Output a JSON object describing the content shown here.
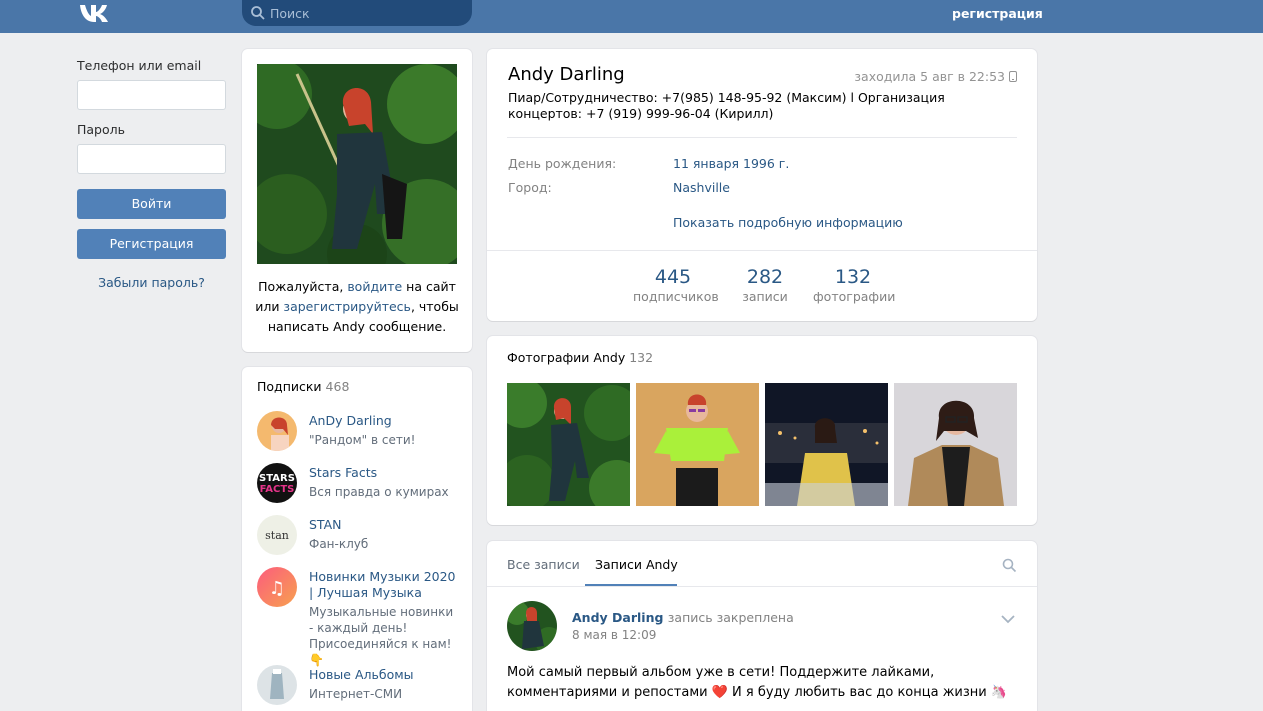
{
  "header": {
    "search_placeholder": "Поиск",
    "register_link": "регистрация"
  },
  "login": {
    "phone_label": "Телефон или email",
    "password_label": "Пароль",
    "login_button": "Войти",
    "register_button": "Регистрация",
    "forgot_link": "Забыли пароль?"
  },
  "message_prompt": {
    "text_before": "Пожалуйста, ",
    "login_link": "войдите",
    "text_middle": " на сайт или ",
    "register_link": "зарегистрируйтесь",
    "text_after": ", чтобы написать Andy сообщение."
  },
  "subscriptions": {
    "title": "Подписки",
    "count": "468",
    "items": [
      {
        "name": "AnDy Darling",
        "desc": "\"Рандом\" в сети!"
      },
      {
        "name": "Stars Facts",
        "desc": "Вся правда о кумирах"
      },
      {
        "name": "STAN",
        "desc": "Фан-клуб"
      },
      {
        "name": "Новинки Музыки 2020 | Лучшая Музыка",
        "desc": "Музыкальные новинки - каждый день! Присоединяйся к нам! 👇"
      },
      {
        "name": "Новые Альбомы",
        "desc": "Интернет-СМИ"
      }
    ]
  },
  "profile": {
    "name": "Andy Darling",
    "last_seen": "заходила 5 авг в 22:53",
    "status": "Пиар/Сотрудничество: +7(985) 148-95-92 (Максим) l Организация концертов: +7 (919) 999-96-04 (Кирилл)",
    "birthday_label": "День рождения:",
    "birthday_value": "11 января 1996 г.",
    "city_label": "Город:",
    "city_value": "Nashville",
    "show_more": "Показать подробную информацию",
    "stats": [
      {
        "value": "445",
        "label": "подписчиков"
      },
      {
        "value": "282",
        "label": "записи"
      },
      {
        "value": "132",
        "label": "фотографии"
      }
    ]
  },
  "photos": {
    "title": "Фотографии Andy",
    "count": "132"
  },
  "wall": {
    "tabs": [
      "Все записи",
      "Записи Andy"
    ],
    "post": {
      "author": "Andy Darling",
      "pinned": "запись закреплена",
      "date": "8 мая в 12:09",
      "text": "Мой самый первый альбом уже в сети! Поддержите лайками, комментариями и репостами ❤️ И я буду любить вас до конца жизни 🦄"
    }
  },
  "colors": {
    "topbar": "#4a76a8",
    "accent": "#5181b8",
    "link": "#2a5885"
  }
}
